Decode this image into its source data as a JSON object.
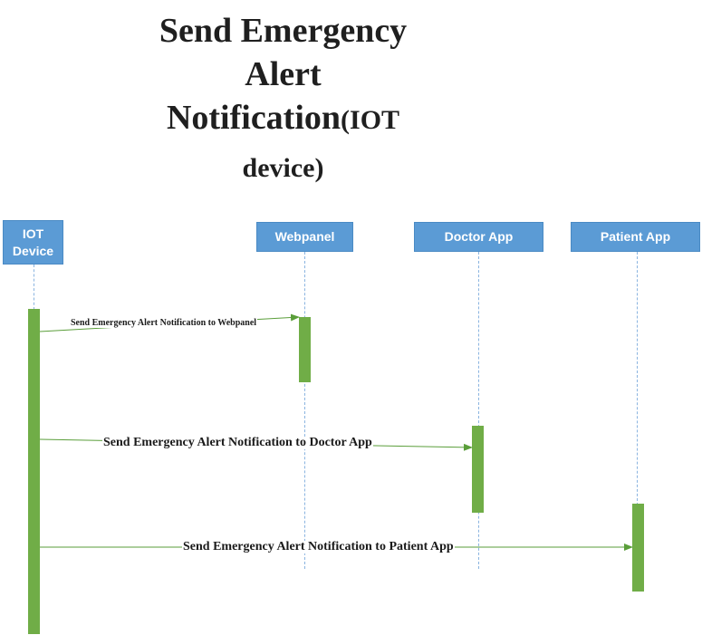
{
  "title": {
    "line1": "Send Emergency",
    "line2": "Alert",
    "line3_main": "Notification",
    "line3_tail": "(IOT",
    "line4": "device)"
  },
  "actors": {
    "iot_line1": "IOT",
    "iot_line2": "Device",
    "webpanel": "Webpanel",
    "doctor": "Doctor App",
    "patient": "Patient  App"
  },
  "messages": {
    "to_webpanel": "Send Emergency Alert Notification to Webpanel",
    "to_doctor": "Send Emergency Alert Notification to Doctor App",
    "to_patient": "Send Emergency Alert Notification to Patient App"
  },
  "colors": {
    "actor_fill": "#5b9bd5",
    "activation": "#70ad47",
    "lifeline": "#8ab4e0"
  }
}
